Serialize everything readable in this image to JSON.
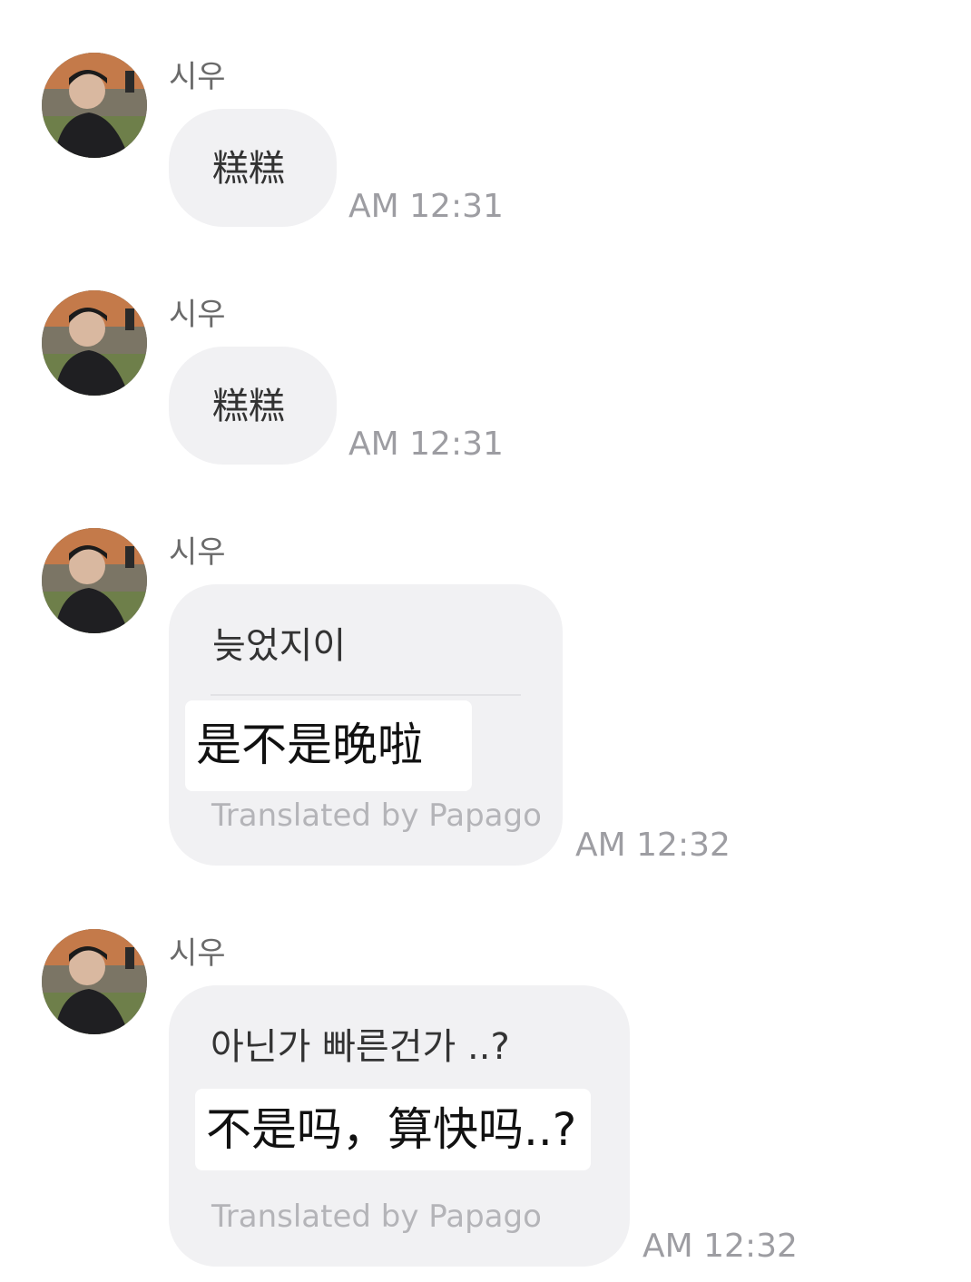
{
  "messages": [
    {
      "sender": "시우",
      "text": "糕糕",
      "time": "AM 12:31"
    },
    {
      "sender": "시우",
      "text": "糕糕",
      "time": "AM 12:31"
    },
    {
      "sender": "시우",
      "text": "늦었지이",
      "translation": "是不是晚啦",
      "translated_by": "Translated by Papago",
      "time": "AM 12:32"
    },
    {
      "sender": "시우",
      "text": "아닌가 빠른건가 ..?",
      "translation": "不是吗，算快吗..?",
      "translated_by": "Translated by Papago",
      "time": "AM 12:32"
    }
  ]
}
